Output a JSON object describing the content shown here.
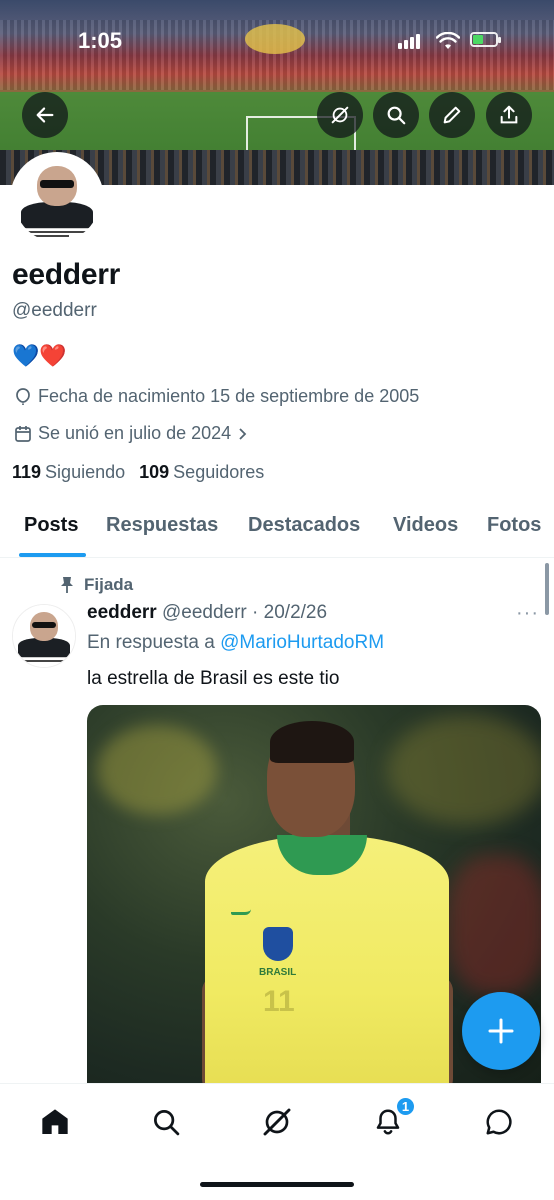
{
  "status_bar": {
    "time": "1:05"
  },
  "banner": {
    "buttons": [
      {
        "icon": "back-arrow-icon"
      },
      {
        "icon": "grok-icon"
      },
      {
        "icon": "search-icon"
      },
      {
        "icon": "edit-pencil-icon"
      },
      {
        "icon": "share-icon"
      }
    ]
  },
  "profile": {
    "name": "eedderr",
    "handle": "@eedderr",
    "bio": "💙❤️",
    "birth": "Fecha de nacimiento 15 de septiembre de 2005",
    "joined": "Se unió en julio de 2024",
    "following_count": "119",
    "following_label": "Siguiendo",
    "followers_count": "109",
    "followers_label": "Seguidores"
  },
  "tabs": [
    {
      "label": "Posts",
      "active": true
    },
    {
      "label": "Respuestas"
    },
    {
      "label": "Destacados"
    },
    {
      "label": "Videos"
    },
    {
      "label": "Fotos"
    }
  ],
  "post": {
    "pinned_label": "Fijada",
    "author_name": "eedderr",
    "author_handle": "@eedderr",
    "date": "· 20/2/26",
    "reply_prefix": "En respuesta a",
    "reply_to": "@MarioHurtadoRM",
    "text": "la estrella de Brasil es este tio",
    "more": "···",
    "media_jersey_text": "BRASIL",
    "media_number": "11"
  },
  "bottom_nav": {
    "items": [
      "home-icon",
      "search-icon",
      "grok-icon",
      "notifications-icon",
      "messages-icon"
    ],
    "notification_count": "1"
  },
  "colors": {
    "accent": "#1d9bf0",
    "text": "#0f1419",
    "muted": "#536471"
  }
}
